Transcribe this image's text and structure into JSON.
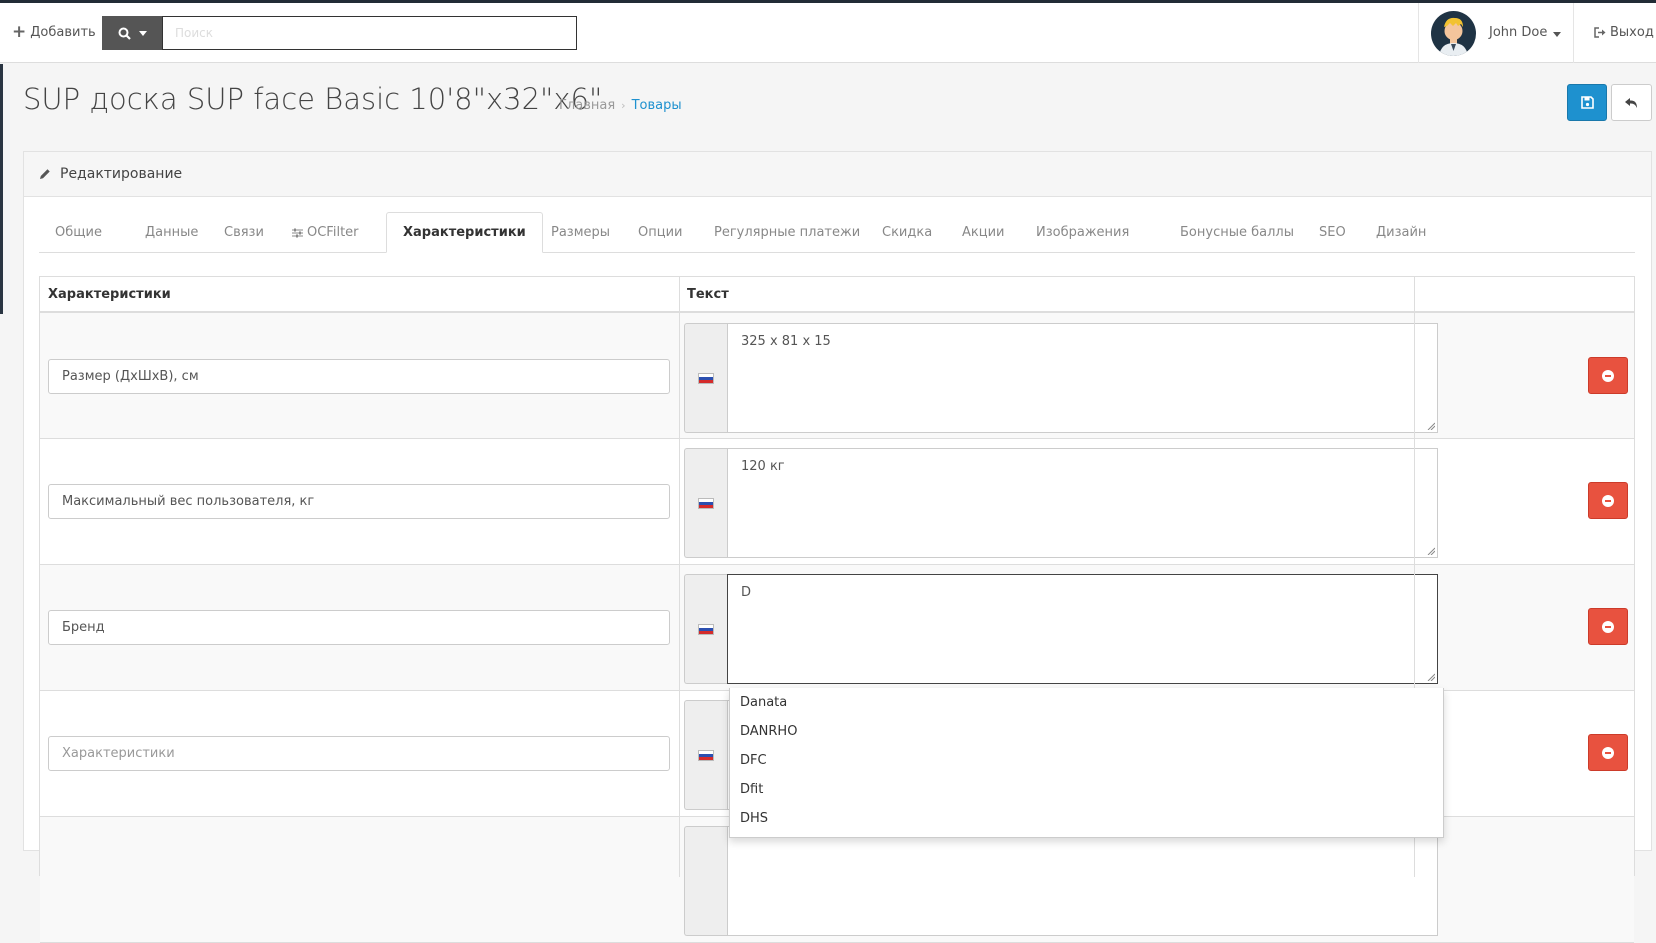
{
  "header": {
    "add_label": "Добавить",
    "search_placeholder": "Поиск",
    "user_name": "John Doe",
    "logout_label": "Выход"
  },
  "page": {
    "title": "SUP доска SUP face Basic 10'8\"x32\"x6\"",
    "breadcrumbs": [
      "Главная",
      "Товары"
    ]
  },
  "panel": {
    "heading": "Редактирование",
    "tabs": [
      "Общие",
      "Данные",
      "Связи",
      "OCFilter",
      "Характеристики",
      "Размеры",
      "Опции",
      "Регулярные платежи",
      "Скидка",
      "Акции",
      "Изображения",
      "Бонусные баллы",
      "SEO",
      "Дизайн"
    ],
    "active_tab": "Характеристики"
  },
  "table": {
    "headers": [
      "Характеристики",
      "Текст"
    ],
    "rows": [
      {
        "attribute": "Размер (ДхШхВ), см",
        "text": "325 x 81 x 15"
      },
      {
        "attribute": "Максимальный вес пользователя, кг",
        "text": "120 кг"
      },
      {
        "attribute": "Бренд",
        "text": "D"
      },
      {
        "attribute": "",
        "attribute_placeholder": "Характеристики",
        "text": ""
      }
    ]
  },
  "autocomplete": [
    "Danata",
    "DANRHO",
    "DFC",
    "Dfit",
    "DHS"
  ],
  "colors": {
    "primary": "#1e91cf",
    "danger": "#e8523f",
    "search_button": "#555555",
    "header_strip": "#222c36"
  },
  "icons": {
    "add": "plus-icon",
    "search": "search-icon",
    "logout": "sign-out-icon",
    "edit": "pencil-icon",
    "save": "save-icon",
    "back": "reply-icon",
    "ocfilter": "sliders-icon",
    "delete": "minus-circle-icon",
    "language": "russian-flag-icon"
  }
}
